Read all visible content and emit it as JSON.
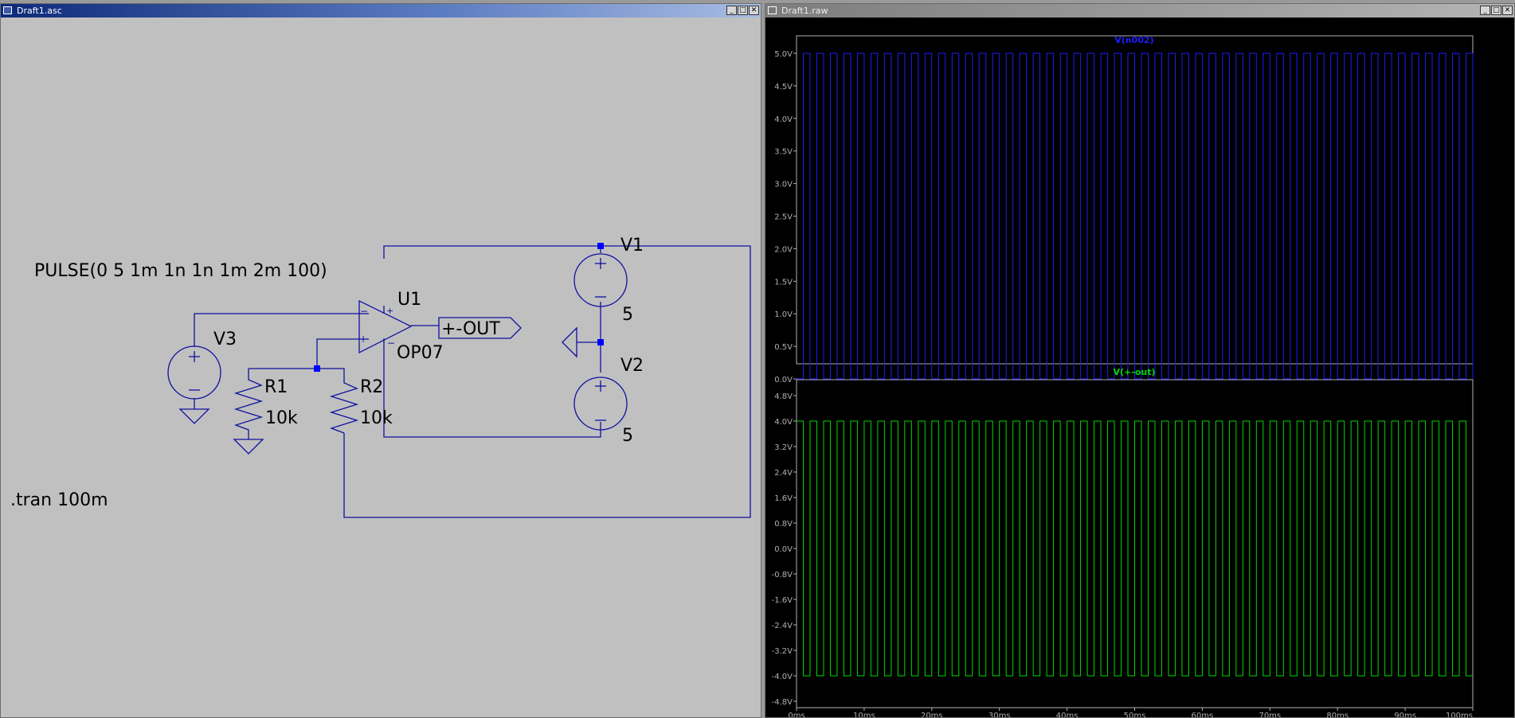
{
  "schematic_window": {
    "title": "Draft1.asc",
    "buttons": {
      "minimize": "_",
      "restore": "□",
      "close": "✕"
    },
    "spice_directive": ".tran 100m",
    "pulse_text": "PULSE(0 5 1m 1n 1n 1m 2m 100)",
    "components": {
      "u1_name": "U1",
      "u1_model": "OP07",
      "v1_name": "V1",
      "v1_value": "5",
      "v2_name": "V2",
      "v2_value": "5",
      "v3_name": "V3",
      "r1_name": "R1",
      "r1_value": "10k",
      "r2_name": "R2",
      "r2_value": "10k",
      "out_label": "+-OUT"
    },
    "colors": {
      "background": "#c0c0c0",
      "wire": "#1010a0",
      "junction": "#0000ff"
    }
  },
  "plot_window": {
    "title": "Draft1.raw",
    "buttons": {
      "minimize": "_",
      "restore": "□",
      "close": "✕"
    },
    "colors": {
      "background": "#000000",
      "axis": "#b0b0b0",
      "trace1": "#1c1cff",
      "trace2": "#00d800"
    }
  },
  "chart_data": [
    {
      "type": "line",
      "title": "V(n002)",
      "x_unit": "ms",
      "xlim": [
        0,
        100
      ],
      "ylim": [
        0,
        5
      ],
      "y_tick_labels": [
        "5.0V",
        "4.5V",
        "4.0V",
        "3.5V",
        "3.0V",
        "2.5V",
        "2.0V",
        "1.5V",
        "1.0V",
        "0.5V",
        "0.0V"
      ],
      "y_ticks": [
        5.0,
        4.5,
        4.0,
        3.5,
        3.0,
        2.5,
        2.0,
        1.5,
        1.0,
        0.5,
        0.0
      ],
      "waveform": {
        "shape": "pulse",
        "low": 0,
        "high": 5,
        "delay_ms": 1,
        "on_ms": 1,
        "period_ms": 2
      },
      "series": [
        {
          "name": "V(n002)",
          "color": "#1c1cff"
        }
      ]
    },
    {
      "type": "line",
      "title": "V(+-out)",
      "x_unit": "ms",
      "xlim": [
        0,
        100
      ],
      "ylim": [
        -4.8,
        4.8
      ],
      "y_tick_labels": [
        "4.8V",
        "4.0V",
        "3.2V",
        "2.4V",
        "1.6V",
        "0.8V",
        "0.0V",
        "-0.8V",
        "-1.6V",
        "-2.4V",
        "-3.2V",
        "-4.0V",
        "-4.8V"
      ],
      "y_ticks": [
        4.8,
        4.0,
        3.2,
        2.4,
        1.6,
        0.8,
        0.0,
        -0.8,
        -1.6,
        -2.4,
        -3.2,
        -4.0,
        -4.8
      ],
      "x_tick_labels": [
        "0ms",
        "10ms",
        "20ms",
        "30ms",
        "40ms",
        "50ms",
        "60ms",
        "70ms",
        "80ms",
        "90ms",
        "100ms"
      ],
      "x_ticks": [
        0,
        10,
        20,
        30,
        40,
        50,
        60,
        70,
        80,
        90,
        100
      ],
      "waveform": {
        "shape": "square",
        "low": -4.0,
        "high": 4.0,
        "start_ms": 0,
        "half_period_ms": 1
      },
      "series": [
        {
          "name": "V(+-out)",
          "color": "#00d800"
        }
      ]
    }
  ]
}
